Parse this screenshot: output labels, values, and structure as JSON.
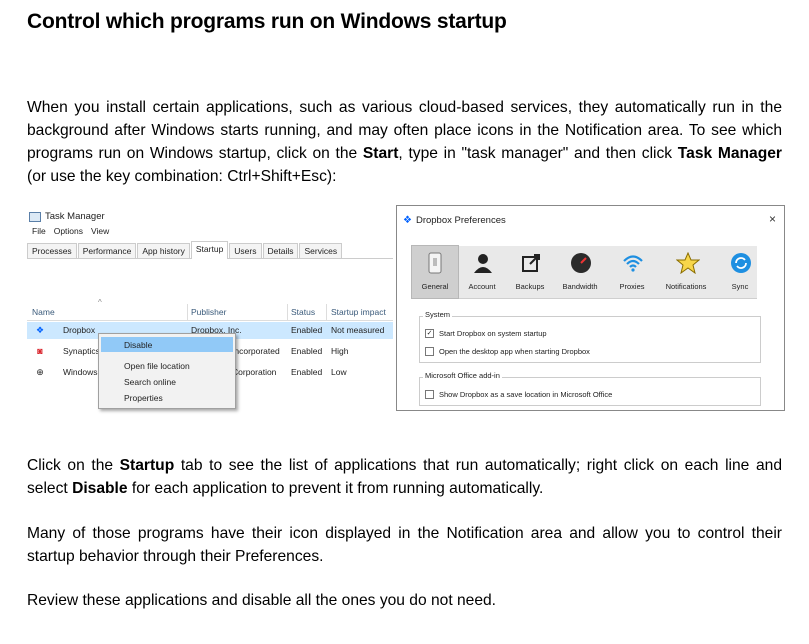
{
  "title": "Control which programs run on Windows startup",
  "p1": {
    "t1": "When you install certain applications, such as various cloud-based services, they automatically run in the background after Windows starts running, and may often place icons in the Notification area. To see which programs run on Windows startup, click on the ",
    "b1": "Start",
    "t2": ", type in \"task manager\" and then click ",
    "b2": "Task Manager",
    "t3": " (or use the key combination: Ctrl+Shift+Esc):"
  },
  "task_manager": {
    "title": "Task Manager",
    "menu": [
      "File",
      "Options",
      "View"
    ],
    "tabs": [
      "Processes",
      "Performance",
      "App history",
      "Startup",
      "Users",
      "Details",
      "Services"
    ],
    "active_tab": "Startup",
    "columns": [
      "Name",
      "Publisher",
      "Status",
      "Startup impact"
    ],
    "rows": [
      {
        "name": "Dropbox",
        "publisher": "Dropbox, Inc.",
        "status": "Enabled",
        "impact": "Not measured"
      },
      {
        "name": "Synaptics",
        "publisher": "Incorporated",
        "status": "Enabled",
        "impact": "High"
      },
      {
        "name": "Windows",
        "publisher": "Corporation",
        "status": "Enabled",
        "impact": "Low"
      }
    ],
    "context_menu": [
      "Disable",
      "Open file location",
      "Search online",
      "Properties"
    ]
  },
  "dropbox": {
    "title": "Dropbox Preferences",
    "close": "×",
    "tabs": [
      "General",
      "Account",
      "Backups",
      "Bandwidth",
      "Proxies",
      "Notifications",
      "Sync"
    ],
    "system_label": "System",
    "system_options": [
      {
        "label": "Start Dropbox on system startup",
        "checked": true
      },
      {
        "label": "Open the desktop app when starting Dropbox",
        "checked": false
      }
    ],
    "office_label": "Microsoft Office add-in",
    "office_option": {
      "label": "Show Dropbox as a save location in Microsoft Office",
      "checked": false
    },
    "check_mark": "✓"
  },
  "p2": {
    "t1": "Click on the ",
    "b1": "Startup",
    "t2": " tab to see the list of applications that run automatically; right click on each line and select ",
    "b2": "Disable",
    "t3": " for each application to prevent it from running automatically."
  },
  "p3": "Many of those programs have their icon displayed in the Notification area and allow you to control their startup behavior through their Preferences.",
  "p4": "Review these applications and disable all the ones you do not need.",
  "icons": {
    "sort": "^",
    "dropbox": "❖",
    "synaptics": "◙",
    "windows": "⊕"
  },
  "colors": {
    "dropbox_blue": "#0061fe",
    "selection": "#cce8ff",
    "menu_highlight": "#91c9f7",
    "synaptics_red": "#d9232b"
  }
}
